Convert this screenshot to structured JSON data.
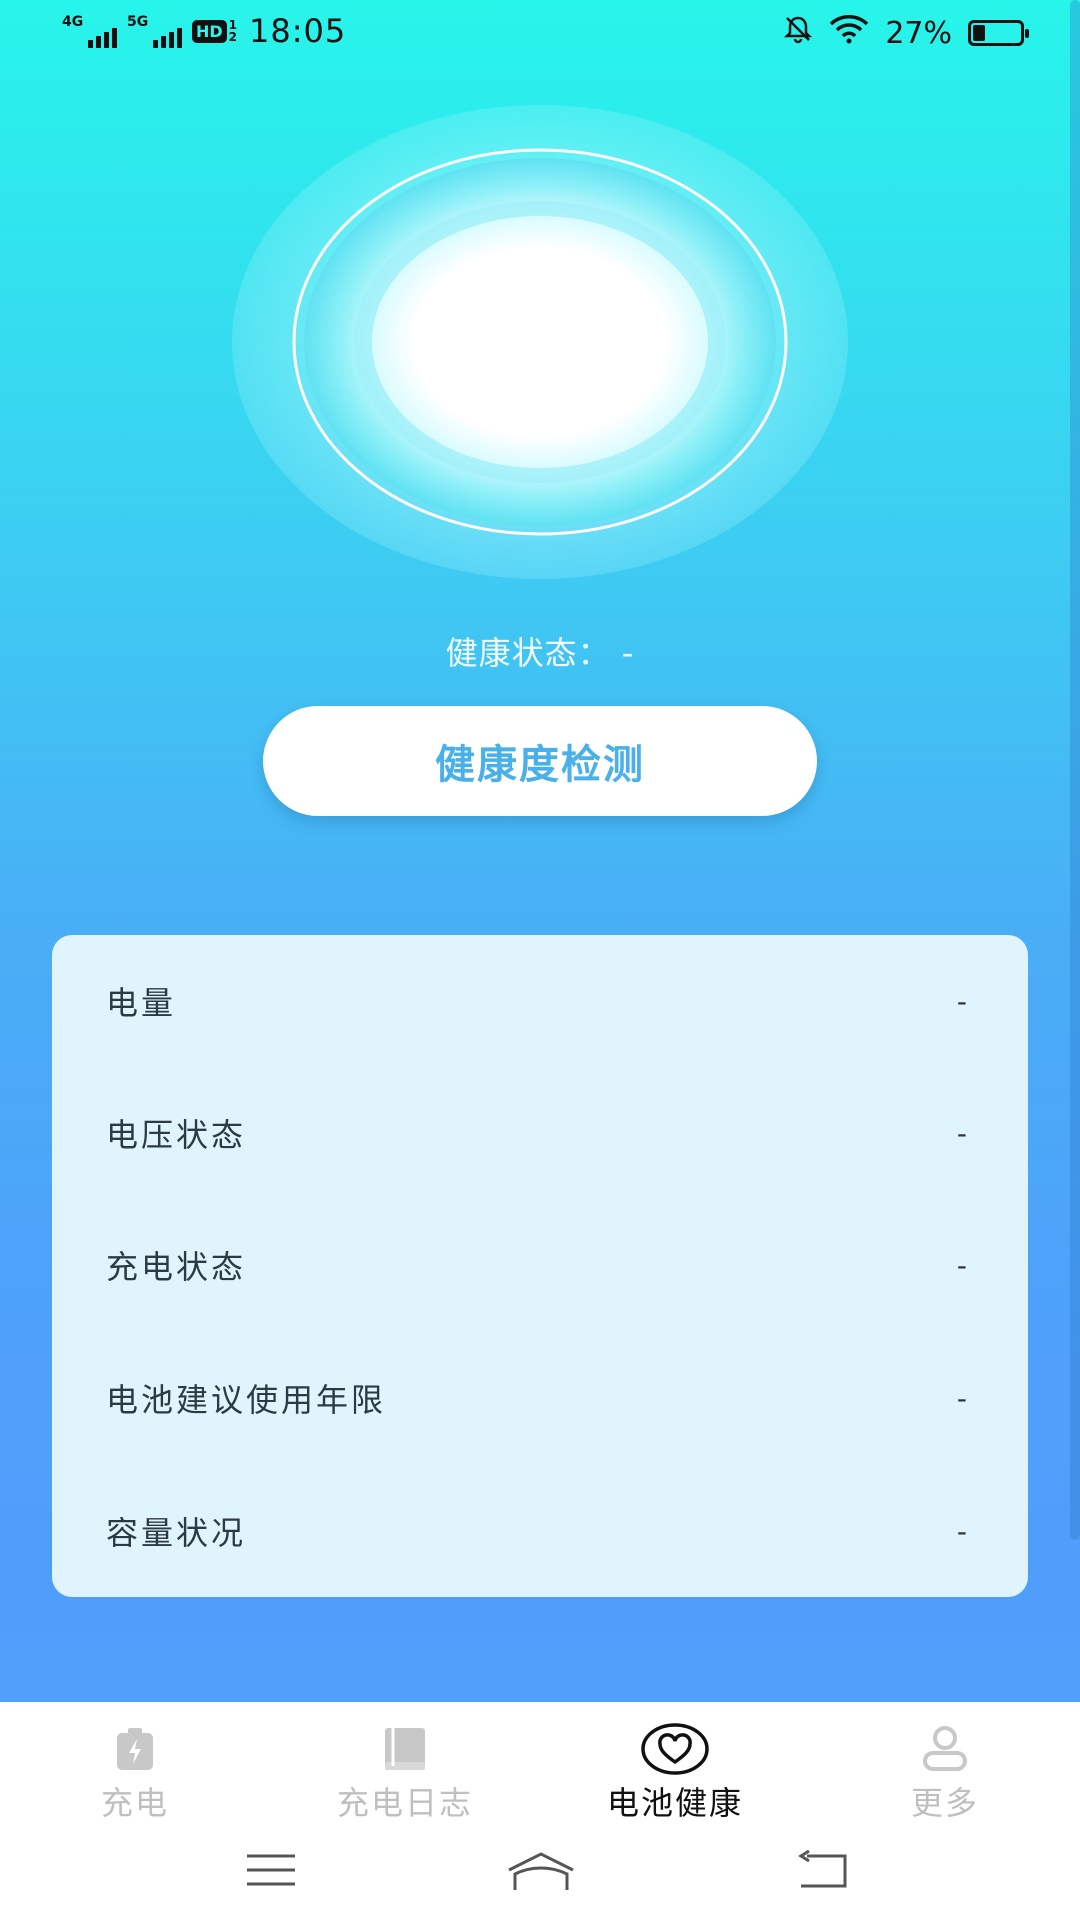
{
  "status_bar": {
    "sig1_label": "4G",
    "sig2_label": "5G",
    "hd_label": "HD",
    "hd_sub": "1\n2",
    "time": "18:05",
    "battery_percent": "27%",
    "battery_level": 0.27,
    "icons": [
      "mute-bell-icon",
      "wifi-icon",
      "battery-icon"
    ]
  },
  "health": {
    "status_text": "健康状态： -",
    "check_button": "健康度检测"
  },
  "info_rows": [
    {
      "label": "电量",
      "value": "-"
    },
    {
      "label": "电压状态",
      "value": "-"
    },
    {
      "label": "充电状态",
      "value": "-"
    },
    {
      "label": "电池建议使用年限",
      "value": "-"
    },
    {
      "label": "容量状况",
      "value": "-"
    }
  ],
  "tabs": [
    {
      "label": "充电",
      "icon": "battery-charge-icon",
      "active": false
    },
    {
      "label": "充电日志",
      "icon": "book-icon",
      "active": false
    },
    {
      "label": "电池健康",
      "icon": "heart-icon",
      "active": true
    },
    {
      "label": "更多",
      "icon": "person-icon",
      "active": false
    }
  ],
  "colors": {
    "gradient_top": "#27f5ea",
    "gradient_bottom": "#519efb",
    "accent_text": "#4ab0ea",
    "card_bg": "#dff4fc"
  },
  "system_nav": [
    "menu-icon",
    "home-icon",
    "back-icon"
  ]
}
